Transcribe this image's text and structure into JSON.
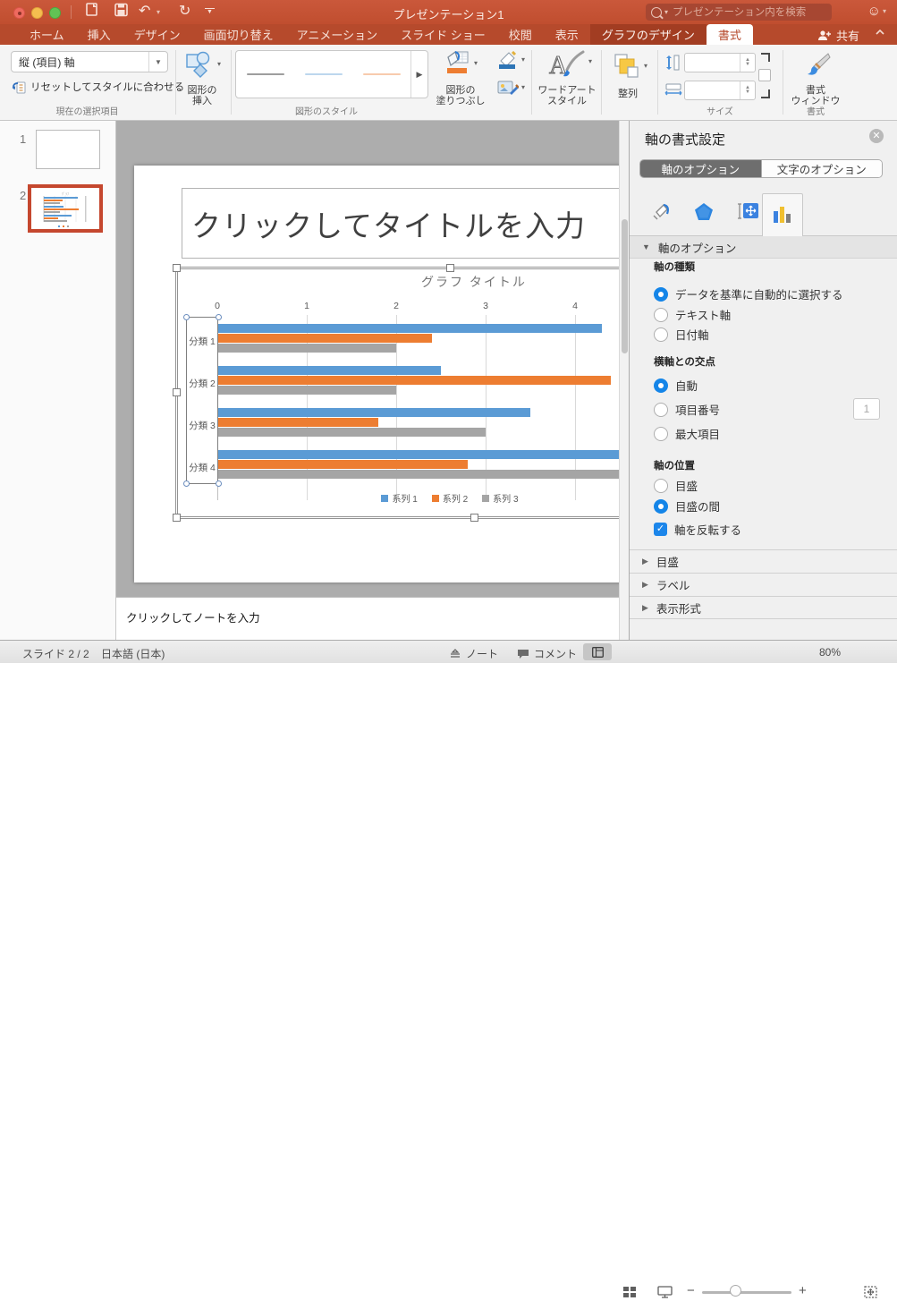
{
  "window": {
    "title": "プレゼンテーション1",
    "search_placeholder": "プレゼンテーション内を検索",
    "share_label": "共有",
    "tabs": [
      "ホーム",
      "挿入",
      "デザイン",
      "画面切り替え",
      "アニメーション",
      "スライド ショー",
      "校閲",
      "表示",
      "グラフのデザイン",
      "書式"
    ],
    "active_tab": "書式",
    "contextual_tab": "グラフのデザイン",
    "toolbar_icons": [
      "new-slide-icon",
      "save-icon",
      "undo-icon",
      "redo-icon",
      "customize-toolbar-icon"
    ],
    "titlebar_icons": [
      "search-icon",
      "smiley-feedback-icon"
    ]
  },
  "ribbon": {
    "current_selection": {
      "dropdown_value": "縦 (項目) 軸",
      "reset_label": "リセットしてスタイルに合わせる",
      "group_label": "現在の選択項目"
    },
    "insert_shapes": {
      "label_lines": [
        "図形の",
        "挿入"
      ]
    },
    "shape_styles": {
      "group_label": "図形のスタイル",
      "fill_label_lines": [
        "図形の",
        "塗りつぶし"
      ],
      "swatch_colors": [
        "#9E9E9E",
        "#BDD7EE",
        "#F8CBAD"
      ]
    },
    "wordart": {
      "label_lines": [
        "ワードアート",
        "スタイル"
      ]
    },
    "arrange_label": "整列",
    "size_group_label": "サイズ",
    "format_pane": {
      "label_lines": [
        "書式",
        "ウィンドウ"
      ],
      "group_label": "書式"
    }
  },
  "slides_panel": {
    "items": [
      {
        "number": "1",
        "selected": false
      },
      {
        "number": "2",
        "selected": true
      }
    ]
  },
  "slide": {
    "title_placeholder": "クリックしてタイトルを入力",
    "notes_placeholder": "クリックしてノートを入力"
  },
  "chart_data": {
    "type": "bar",
    "orientation": "horizontal",
    "title": "グラフ タイトル",
    "categories": [
      "分類 1",
      "分類 2",
      "分類 3",
      "分類 4"
    ],
    "series": [
      {
        "name": "系列 1",
        "color": "#5B9BD5",
        "values": [
          4.3,
          2.5,
          3.5,
          4.5
        ]
      },
      {
        "name": "系列 2",
        "color": "#ED7D31",
        "values": [
          2.4,
          4.4,
          1.8,
          2.8
        ]
      },
      {
        "name": "系列 3",
        "color": "#A5A5A5",
        "values": [
          2.0,
          2.0,
          3.0,
          5.0
        ]
      }
    ],
    "x_ticks": [
      0,
      1,
      2,
      3,
      4
    ],
    "xlim": [
      0,
      4.6
    ],
    "value_axis_position": "top",
    "category_axis_reversed": true,
    "legend_position": "bottom",
    "gridlines": true
  },
  "panel": {
    "title": "軸の書式設定",
    "tabs": [
      {
        "label": "軸のオプション",
        "active": true
      },
      {
        "label": "文字のオプション",
        "active": false
      }
    ],
    "icon_tabs": [
      "fill-line-icon",
      "effects-icon",
      "size-properties-icon",
      "chart-axis-icon"
    ],
    "selected_icon_tab": "chart-axis-icon",
    "section_header": "軸のオプション",
    "groups": {
      "axis_type": {
        "header": "軸の種類",
        "options": [
          {
            "label": "データを基準に自動的に選択する",
            "selected": true
          },
          {
            "label": "テキスト軸",
            "selected": false
          },
          {
            "label": "日付軸",
            "selected": false
          }
        ]
      },
      "crosses": {
        "header": "横軸との交点",
        "options": [
          {
            "label": "自動",
            "selected": true
          },
          {
            "label": "項目番号",
            "selected": false
          },
          {
            "label": "最大項目",
            "selected": false
          }
        ],
        "input_value": "1"
      },
      "position": {
        "header": "軸の位置",
        "options": [
          {
            "label": "目盛",
            "selected": false
          },
          {
            "label": "目盛の間",
            "selected": true
          }
        ]
      }
    },
    "reverse_checkbox": {
      "label": "軸を反転する",
      "checked": true
    },
    "collapsed_sections": [
      "目盛",
      "ラベル",
      "表示形式"
    ]
  },
  "statusbar": {
    "slide_label": "スライド 2 / 2",
    "language": "日本語 (日本)",
    "notes_label": "ノート",
    "comments_label": "コメント",
    "zoom": "80%",
    "view_icons": [
      "normal-view-icon",
      "slide-sorter-icon",
      "presenter-view-icon",
      "fit-window-icon"
    ]
  },
  "colors": {
    "titlebar_red": "#C4512F",
    "tabrow_red": "#B64A2C",
    "contextual_tab_red": "#A23D22",
    "selection_border_red": "#C5472E",
    "radio_blue": "#1485E8",
    "chart_blue": "#5B9BD5",
    "chart_orange": "#ED7D31",
    "chart_gray": "#A5A5A5"
  }
}
